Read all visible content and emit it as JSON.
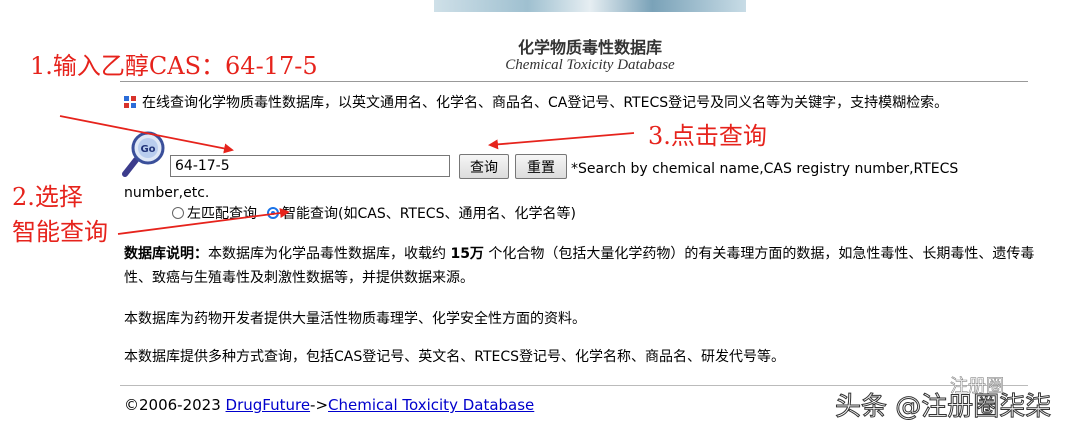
{
  "header": {
    "title": "化学物质毒性数据库",
    "subtitle": "Chemical Toxicity Database"
  },
  "intro": "在线查询化学物质毒性数据库，以英文通用名、化学名、商品名、CA登记号、RTECS登记号及同义名等为关键字，支持模糊检索。",
  "search": {
    "value": "64-17-5",
    "query_label": "查询",
    "reset_label": "重置",
    "hint": "*Search by chemical name,CAS registry number,RTECS number,etc."
  },
  "options": [
    {
      "label": "左匹配查询",
      "checked": false
    },
    {
      "label": "智能查询(如CAS、RTECS、通用名、化学名等)",
      "checked": true
    }
  ],
  "description": {
    "label": "数据库说明：",
    "text_before": "本数据库为化学品毒性数据库，收载约 ",
    "count": "15万",
    "text_after": " 个化合物（包括大量化学药物）的有关毒理方面的数据，如急性毒性、长期毒性、遗传毒性、致癌与生殖毒性及刺激性数据等，并提供数据来源。"
  },
  "paragraphs": [
    "本数据库为药物开发者提供大量活性物质毒理学、化学安全性方面的资料。",
    "本数据库提供多种方式查询，包括CAS登记号、英文名、RTECS登记号、化学名称、商品名、研发代号等。"
  ],
  "footer": {
    "copyright": "©2006-2023 ",
    "link1": "DrugFuture",
    "separator": "->",
    "link2": "Chemical Toxicity Database"
  },
  "annotations": {
    "step1": "1.输入乙醇CAS：64-17-5",
    "step2_line1": "2.选择",
    "step2_line2": "智能查询",
    "step3": "3.点击查询"
  },
  "watermark": {
    "text": "头条 @注册圈柒柒",
    "logo": "注册圈"
  },
  "colors": {
    "annotation": "#e6231c",
    "link": "#0000cc",
    "radio_checked": "#1a73e8"
  }
}
